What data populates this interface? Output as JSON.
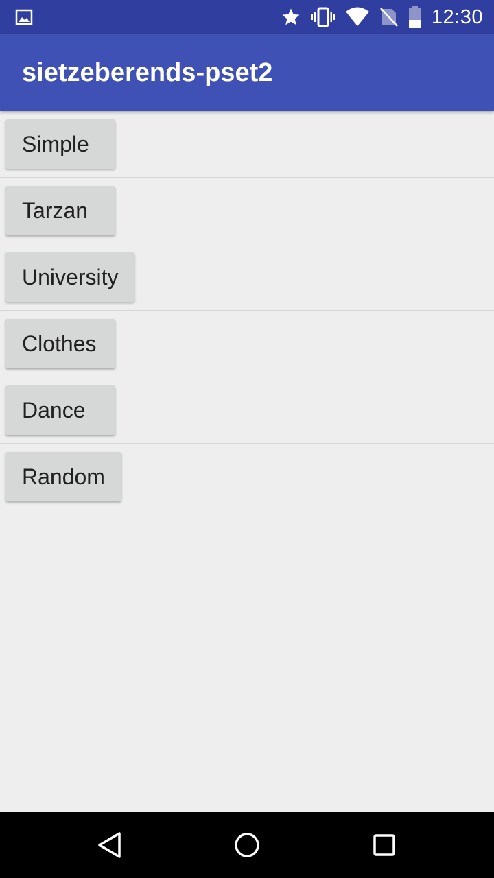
{
  "status_bar": {
    "time": "12:30",
    "icons": [
      "image-notification-icon",
      "star-icon",
      "vibrate-icon",
      "wifi-icon",
      "no-sim-icon",
      "battery-icon"
    ]
  },
  "app_bar": {
    "title": "sietzeberends-pset2"
  },
  "list": {
    "items": [
      {
        "label": "Simple"
      },
      {
        "label": "Tarzan"
      },
      {
        "label": "University"
      },
      {
        "label": "Clothes"
      },
      {
        "label": "Dance"
      },
      {
        "label": "Random"
      }
    ]
  },
  "nav_bar": {
    "buttons": [
      "back-icon",
      "home-icon",
      "recents-icon"
    ]
  },
  "colors": {
    "status_bar": "#303f9f",
    "app_bar": "#3f51b5",
    "background": "#eeeeee",
    "button": "#d6d7d7",
    "nav_bar": "#000000"
  }
}
